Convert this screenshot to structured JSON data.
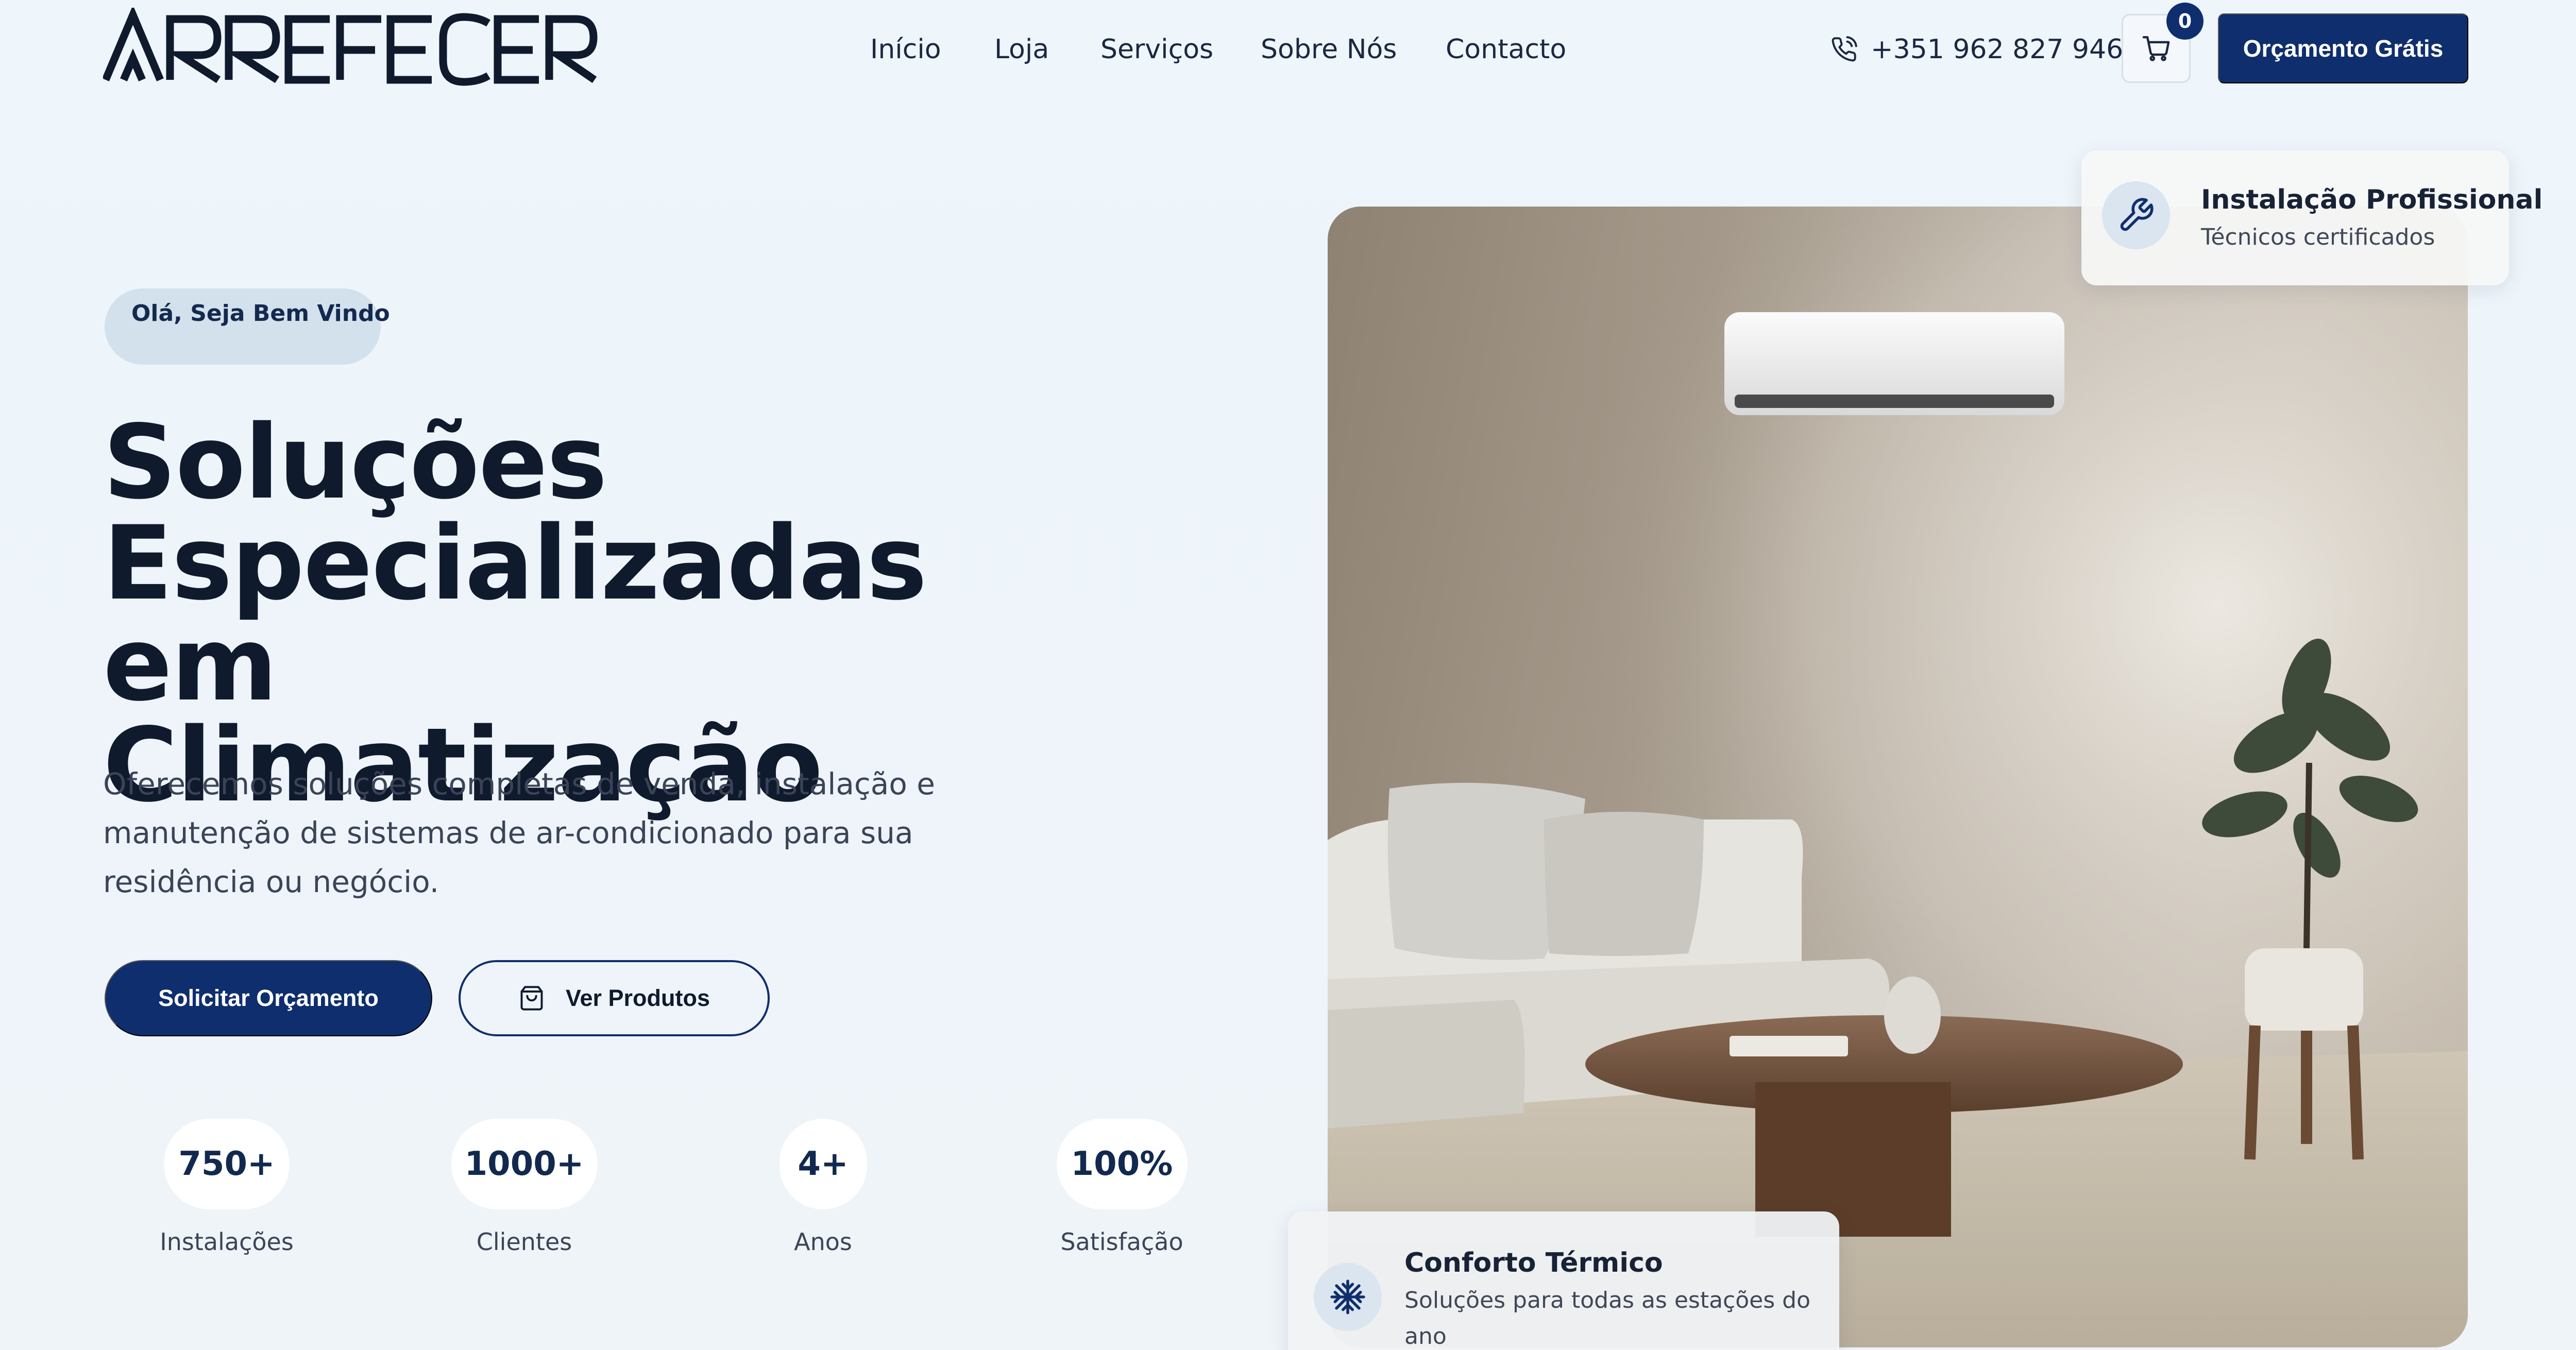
{
  "brand": {
    "name": "ARREFECER",
    "accent": "#0f2e6e"
  },
  "nav": {
    "items": [
      "Início",
      "Loja",
      "Serviços",
      "Sobre Nós",
      "Contacto"
    ]
  },
  "header": {
    "phone": "+351 962 827 946",
    "cart_count": "0",
    "cta_label": "Orçamento Grátis",
    "phone_icon": "phone-icon",
    "cart_icon": "shopping-cart-icon"
  },
  "hero": {
    "badge": "Olá, Seja Bem Vindo",
    "title_lines": [
      "Soluções",
      "Especializadas em",
      "Climatização"
    ],
    "subtitle": "Oferecemos soluções completas de venda, instalação e manutenção de sistemas de ar-condicionado para sua residência ou negócio.",
    "primary_button": "Solicitar Orçamento",
    "secondary_button": "Ver Produtos",
    "secondary_icon": "shopping-bag-icon"
  },
  "stats": [
    {
      "value": "750+",
      "label": "Instalações"
    },
    {
      "value": "1000+",
      "label": "Clientes"
    },
    {
      "value": "4+",
      "label": "Anos"
    },
    {
      "value": "100%",
      "label": "Satisfação"
    }
  ],
  "cards": {
    "top": {
      "icon": "wrench-icon",
      "title": "Instalação Profissional",
      "subtitle": "Técnicos certificados"
    },
    "bottom": {
      "icon": "snowflake-icon",
      "title": "Conforto Térmico",
      "subtitle": "Soluções para todas as estações do ano"
    }
  }
}
